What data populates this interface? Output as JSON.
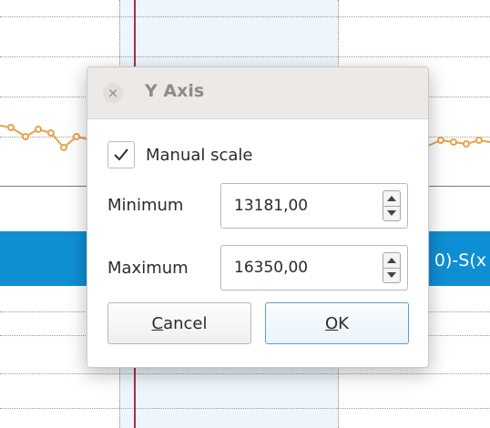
{
  "dialog": {
    "title": "Y Axis",
    "close_glyph": "×",
    "manual_scale": {
      "label": "Manual scale",
      "checked": true
    },
    "minimum": {
      "label": "Minimum",
      "value": "13181,00"
    },
    "maximum": {
      "label": "Maximum",
      "value": "16350,00"
    },
    "cancel_label": "Cancel",
    "cancel_mnemonic": "C",
    "cancel_rest": "ancel",
    "ok_label": "OK",
    "ok_mnemonic": "O",
    "ok_rest": "K"
  },
  "background": {
    "bar_text": "0)-S(x",
    "series_color": "#e8a24a",
    "marker_color": "#a2314b",
    "bar_color": "#0f8fd3"
  },
  "icons": {
    "close": "close-icon",
    "check": "checkmark-icon",
    "spin_up": "arrow-up-icon",
    "spin_down": "arrow-down-icon"
  }
}
